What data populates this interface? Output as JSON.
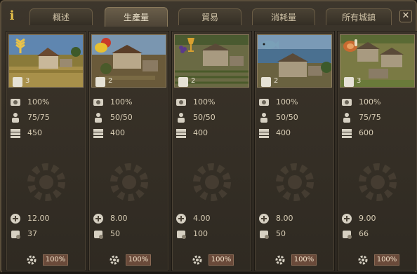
{
  "tabs": [
    {
      "label": "概述",
      "active": false
    },
    {
      "label": "生產量",
      "active": true
    },
    {
      "label": "貿易",
      "active": false
    },
    {
      "label": "消耗量",
      "active": false
    },
    {
      "label": "所有城鎮",
      "active": false
    }
  ],
  "info_icon": "i",
  "close_icon": "✕",
  "columns": [
    {
      "resource": "wheat",
      "level": "3",
      "efficiency": "100%",
      "workers": "75/75",
      "capacity": "450",
      "rate": "12.00",
      "stock": "37",
      "priority": "100%"
    },
    {
      "resource": "fruit",
      "level": "2",
      "efficiency": "100%",
      "workers": "50/50",
      "capacity": "400",
      "rate": "8.00",
      "stock": "50",
      "priority": "100%"
    },
    {
      "resource": "wine",
      "level": "2",
      "efficiency": "100%",
      "workers": "50/50",
      "capacity": "400",
      "rate": "4.00",
      "stock": "100",
      "priority": "100%"
    },
    {
      "resource": "fish",
      "level": "2",
      "efficiency": "100%",
      "workers": "50/50",
      "capacity": "400",
      "rate": "8.00",
      "stock": "50",
      "priority": "100%"
    },
    {
      "resource": "meat",
      "level": "3",
      "efficiency": "100%",
      "workers": "75/75",
      "capacity": "600",
      "rate": "9.00",
      "stock": "66",
      "priority": "100%"
    }
  ],
  "colors": {
    "accent": "#e8c24a",
    "priority_bg": "#6a4a3a"
  }
}
